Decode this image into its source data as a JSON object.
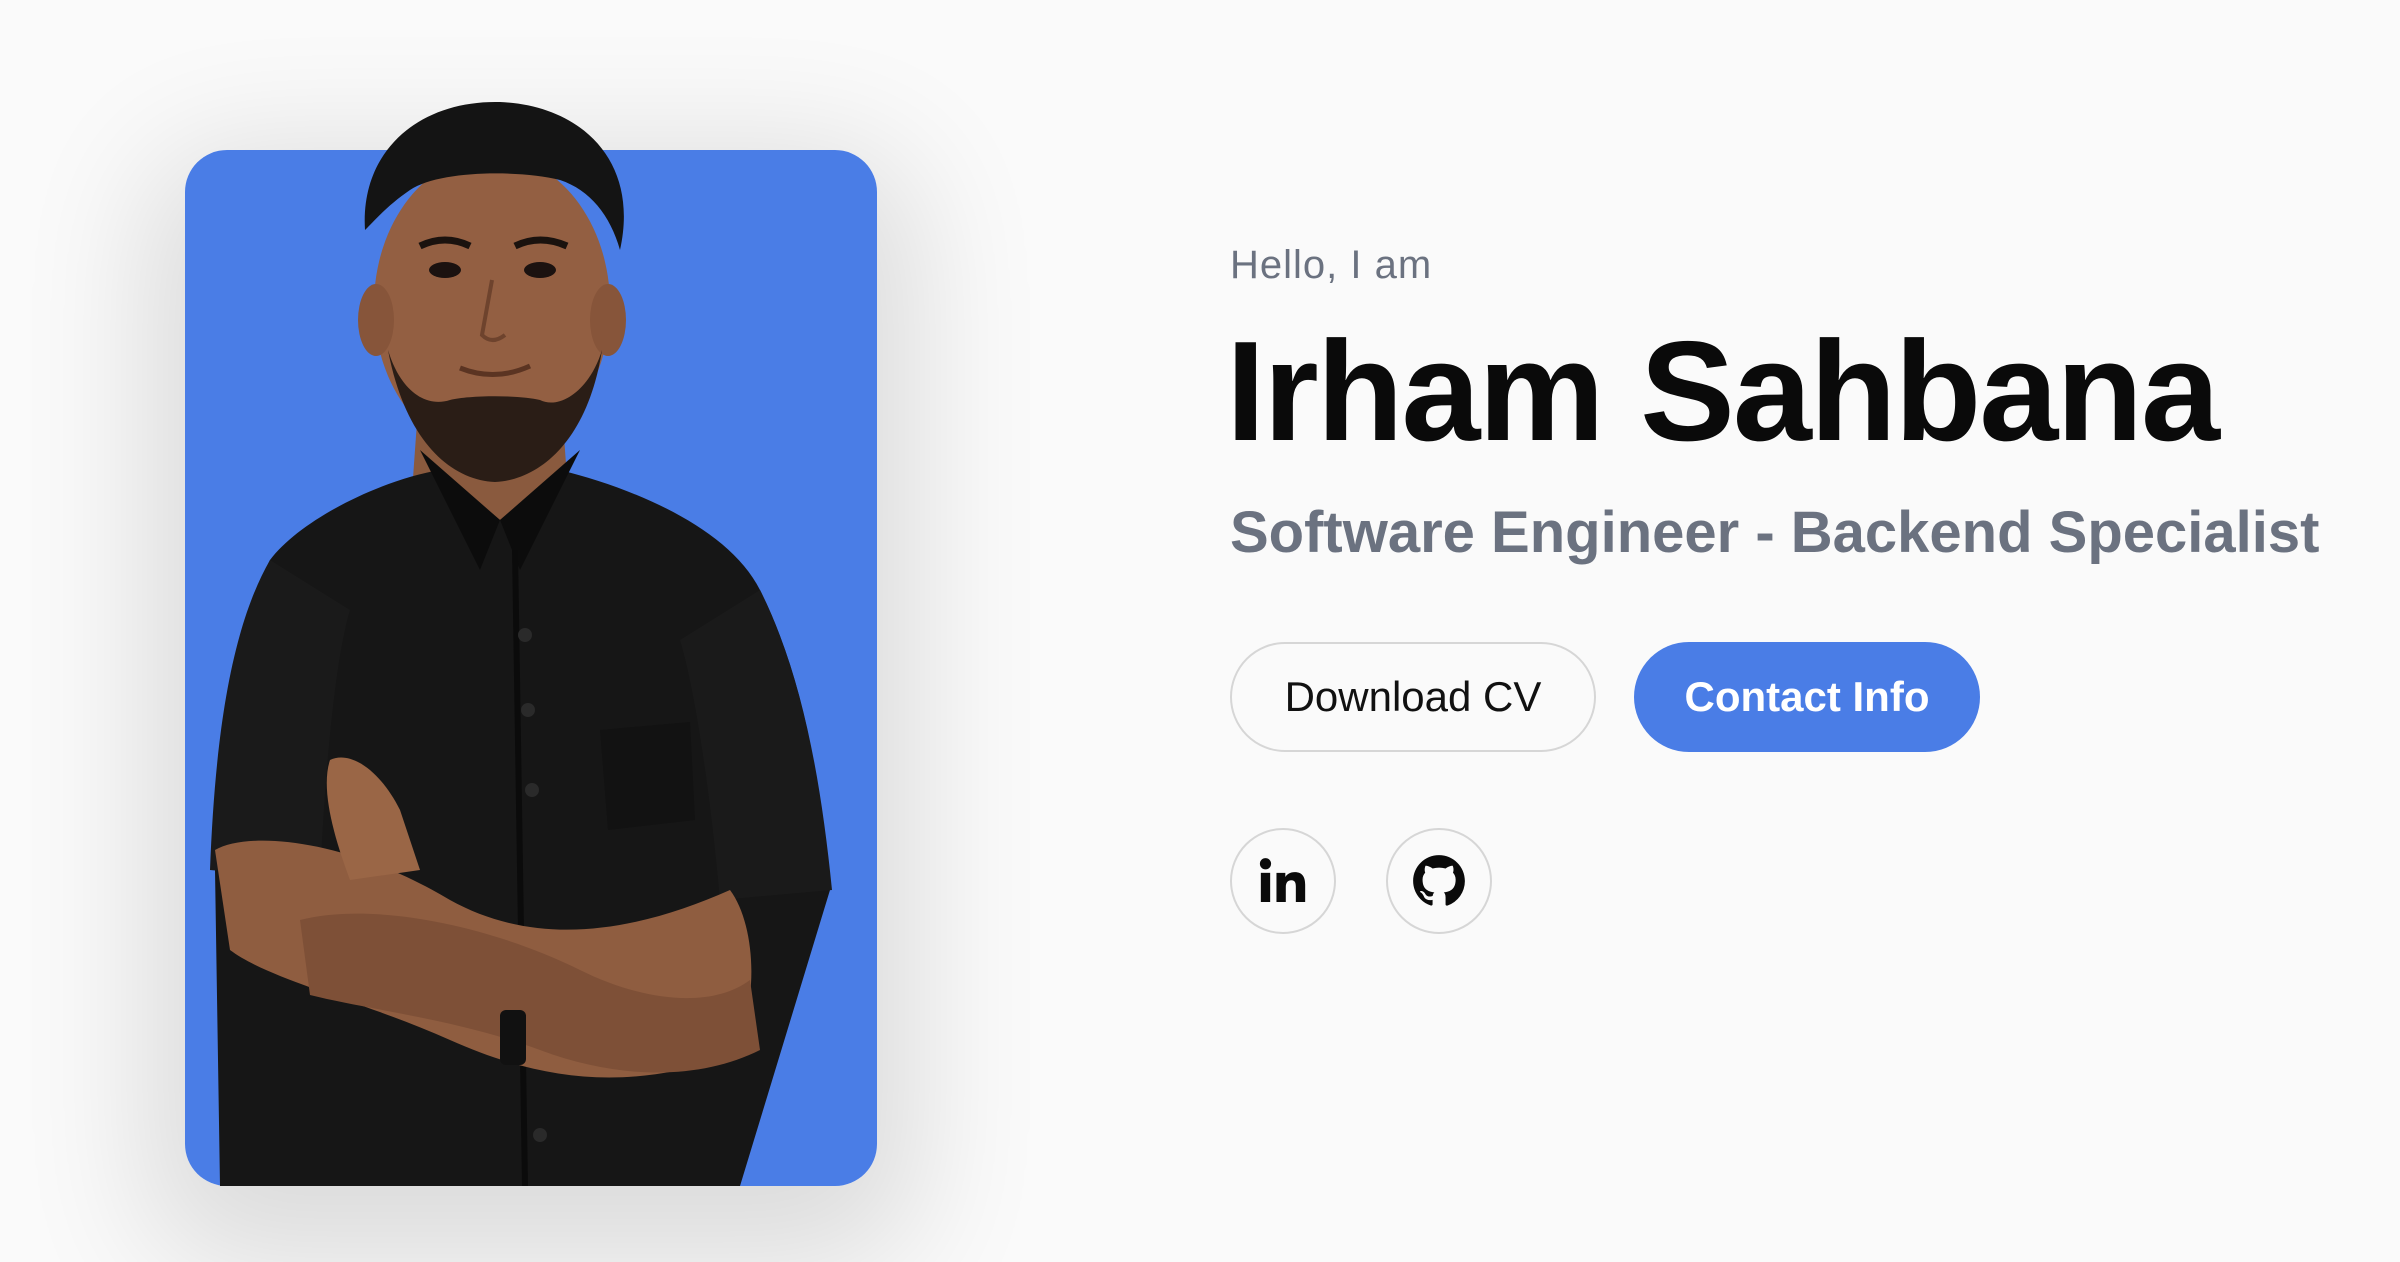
{
  "profile": {
    "greeting": "Hello, I am",
    "name": "Irham Sahbana",
    "role": "Software Engineer - Backend Specialist"
  },
  "actions": {
    "download_cv_label": "Download CV",
    "contact_info_label": "Contact Info"
  },
  "socials": [
    {
      "icon": "linkedin-icon"
    },
    {
      "icon": "github-icon"
    }
  ],
  "colors": {
    "accent": "#4a7de6",
    "background": "#fafafa",
    "heading": "#0a0a0a",
    "muted_text": "#6b7280",
    "border": "#d6d6d6"
  }
}
